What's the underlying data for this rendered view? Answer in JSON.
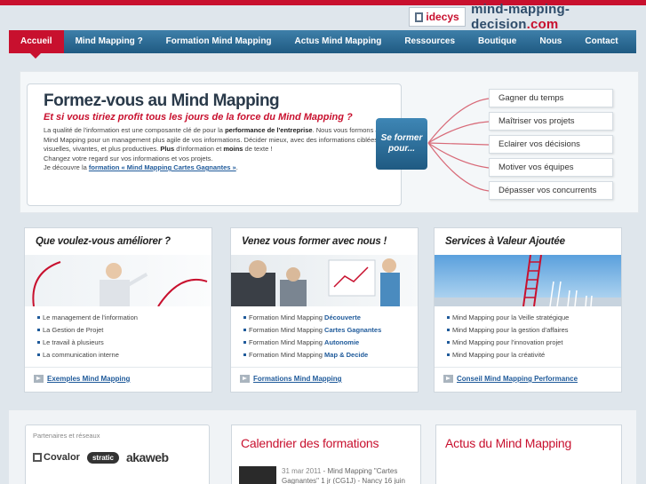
{
  "header": {
    "logo_brand": "idecys",
    "site_name_prefix": "mind-mapping-decision",
    "site_name_suffix": ".com"
  },
  "nav": {
    "items": [
      "Accueil",
      "Mind Mapping ?",
      "Formation Mind Mapping",
      "Actus Mind Mapping",
      "Ressources",
      "Boutique",
      "Nous",
      "Contact"
    ]
  },
  "hero": {
    "title": "Formez-vous au Mind Mapping",
    "subtitle": "Et si vous tiriez profit tous les jours de la force du Mind Mapping ?",
    "p1_a": "La qualité de l'information est une composante clé de pour la ",
    "p1_b": "performance de l'entreprise",
    "p1_c": ". Nous vous formons au Mind Mapping pour un management plus agile de vos informations. Décider mieux, avec des informations ciblées, visuelles, vivantes, et plus productives. ",
    "p1_d": "Plus",
    "p1_e": " d'information et ",
    "p1_f": "moins",
    "p1_g": " de texte !",
    "p2": "Changez votre regard sur vos informations et vos projets.",
    "p3_a": "Je découvre la ",
    "p3_link": "formation « Mind Mapping Cartes Gagnantes »",
    "p3_b": ".",
    "cta": "Se former pour...",
    "benefits": [
      "Gagner du temps",
      "Maîtriser vos projets",
      "Eclairer vos décisions",
      "Motiver vos équipes",
      "Dépasser vos concurrents"
    ]
  },
  "cards": [
    {
      "title": "Que voulez-vous améliorer ?",
      "items": [
        "Le management de l'information",
        "La Gestion de Projet",
        "Le travail à plusieurs",
        "La communication interne"
      ],
      "link": "Exemples Mind Mapping"
    },
    {
      "title": "Venez vous former avec nous !",
      "prefix": "Formation Mind Mapping ",
      "items": [
        "Découverte",
        "Cartes Gagnantes",
        "Autonomie",
        "Map & Decide"
      ],
      "link": "Formations Mind Mapping"
    },
    {
      "title": "Services à Valeur Ajoutée",
      "items": [
        "Mind Mapping pour la Veille stratégique",
        "Mind Mapping pour la gestion d'affaires",
        "Mind Mapping pour l'innovation projet",
        "Mind Mapping pour la créativité"
      ],
      "link": "Conseil Mind Mapping Performance"
    }
  ],
  "partners": {
    "title": "Partenaires et réseaux",
    "logos": [
      "Covalor",
      "stratic",
      "akaweb"
    ]
  },
  "calendar": {
    "title": "Calendrier des formations",
    "event_date": "31 mar 2011",
    "event_text": " - Mind Mapping \"Cartes Gagnantes\" 1 jr (CG1J) - Nancy 16 juin"
  },
  "news": {
    "title": "Actus du Mind Mapping"
  },
  "colors": {
    "brand_red": "#c8102e",
    "nav_blue": "#1f5a82",
    "link_blue": "#1f5a9a"
  }
}
